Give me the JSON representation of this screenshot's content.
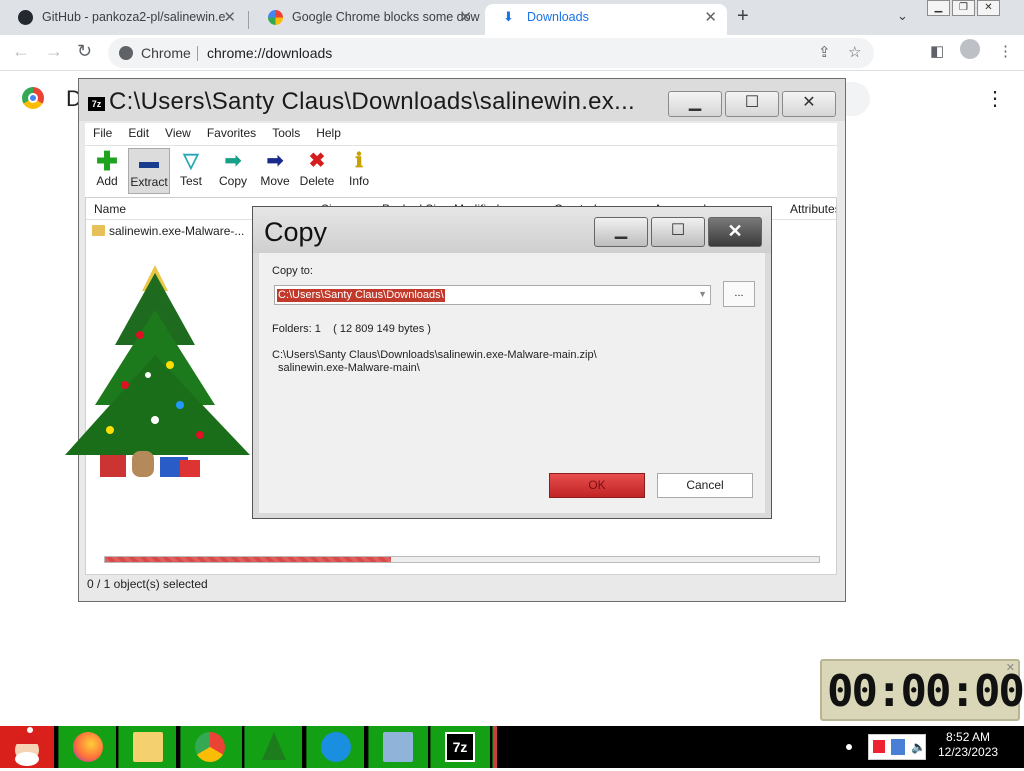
{
  "browser": {
    "tabs": [
      {
        "label": "GitHub - pankoza2-pl/salinewin.e",
        "icon": "github-icon",
        "active": false
      },
      {
        "label": "Google Chrome blocks some dow",
        "icon": "google-icon",
        "active": false
      },
      {
        "label": "Downloads",
        "icon": "download-icon",
        "active": true
      }
    ],
    "omnibox_label": "Chrome",
    "url": "chrome://downloads"
  },
  "downloads_page": {
    "title": "D"
  },
  "sevenzip": {
    "title": "C:\\Users\\Santy Claus\\Downloads\\salinewin.ex...",
    "menu": [
      "File",
      "Edit",
      "View",
      "Favorites",
      "Tools",
      "Help"
    ],
    "toolbar": [
      {
        "label": "Add",
        "icon": "plus-icon",
        "color": "#1fa31f"
      },
      {
        "label": "Extract",
        "icon": "extract-icon",
        "color": "#1a3c8c"
      },
      {
        "label": "Test",
        "icon": "test-icon",
        "color": "#2aa7b5"
      },
      {
        "label": "Copy",
        "icon": "copy-arrow-icon",
        "color": "#16a08a"
      },
      {
        "label": "Move",
        "icon": "move-arrow-icon",
        "color": "#1a2a8a"
      },
      {
        "label": "Delete",
        "icon": "delete-x-icon",
        "color": "#d41e1e"
      },
      {
        "label": "Info",
        "icon": "info-icon",
        "color": "#c8a000"
      }
    ],
    "columns": [
      "Name",
      "Size",
      "Packed Size",
      "Modified",
      "Created",
      "Accessed",
      "Attributes"
    ],
    "rows": [
      {
        "name": "salinewin.exe-Malware-..."
      }
    ],
    "progress": 0.4,
    "status": "0 / 1 object(s) selected"
  },
  "copy_dialog": {
    "title": "Copy",
    "copy_to_label": "Copy to:",
    "destination": "C:\\Users\\Santy Claus\\Downloads\\",
    "browse_label": "...",
    "folders_info": "Folders: 1    ( 12 809 149 bytes )",
    "source_path_line1": "C:\\Users\\Santy Claus\\Downloads\\salinewin.exe-Malware-main.zip\\",
    "source_path_line2": "salinewin.exe-Malware-main\\",
    "ok_label": "OK",
    "cancel_label": "Cancel"
  },
  "timer": {
    "display": "00:00:00"
  },
  "taskbar": {
    "time": "8:52 AM",
    "date": "12/23/2023",
    "apps": [
      "santa-start-icon",
      "firefox-icon",
      "file-explorer-icon",
      "chrome-icon",
      "christmas-tree-icon",
      "messenger-icon",
      "computer-icon",
      "7zip-icon"
    ]
  }
}
